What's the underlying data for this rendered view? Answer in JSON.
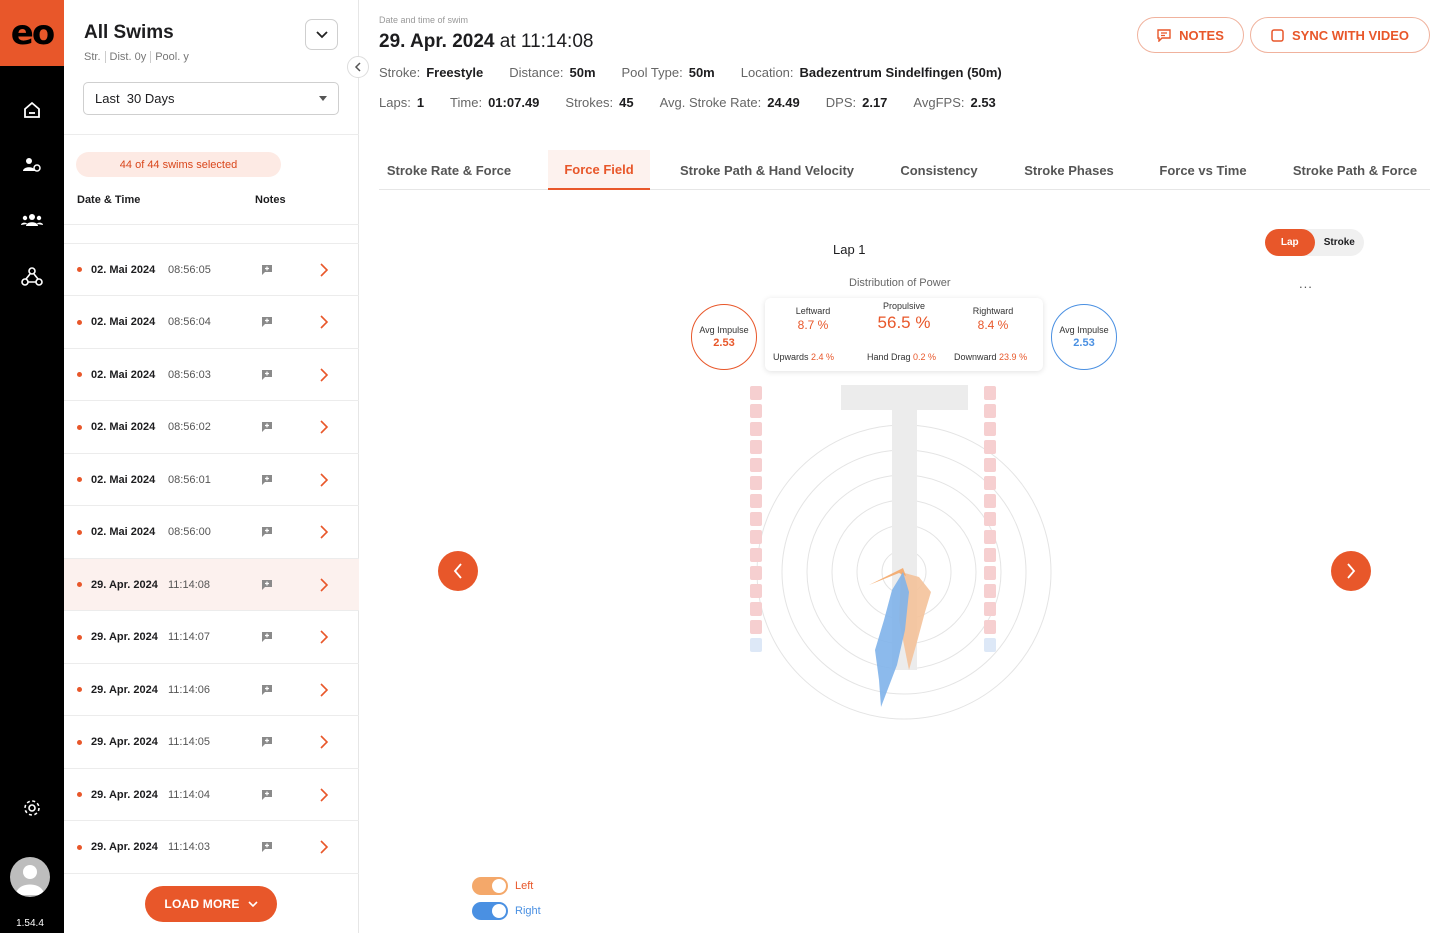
{
  "sidebar": {
    "logo": "eo",
    "version": "1.54.4",
    "icons": [
      "home-icon",
      "user-settings-icon",
      "team-icon",
      "network-icon"
    ],
    "settings_icon": "gear-icon"
  },
  "swim_list": {
    "title": "All Swims",
    "filters": [
      "Str.",
      "Dist. 0y",
      "Pool. y"
    ],
    "date_range": "Last  30 Days",
    "selected_text": "44 of 44 swims selected",
    "col_date": "Date & Time",
    "col_notes": "Notes",
    "rows": [
      {
        "date": "02. Mai 2024",
        "time": "08:56:05",
        "active": false
      },
      {
        "date": "02. Mai 2024",
        "time": "08:56:04",
        "active": false
      },
      {
        "date": "02. Mai 2024",
        "time": "08:56:03",
        "active": false
      },
      {
        "date": "02. Mai 2024",
        "time": "08:56:02",
        "active": false
      },
      {
        "date": "02. Mai 2024",
        "time": "08:56:01",
        "active": false
      },
      {
        "date": "02. Mai 2024",
        "time": "08:56:00",
        "active": false
      },
      {
        "date": "29. Apr. 2024",
        "time": "11:14:08",
        "active": true
      },
      {
        "date": "29. Apr. 2024",
        "time": "11:14:07",
        "active": false
      },
      {
        "date": "29. Apr. 2024",
        "time": "11:14:06",
        "active": false
      },
      {
        "date": "29. Apr. 2024",
        "time": "11:14:05",
        "active": false
      },
      {
        "date": "29. Apr. 2024",
        "time": "11:14:04",
        "active": false
      },
      {
        "date": "29. Apr. 2024",
        "time": "11:14:03",
        "active": false
      }
    ],
    "load_more": "LOAD MORE"
  },
  "header": {
    "meta_label": "Date and time of swim",
    "date": "29. Apr. 2024",
    "at": "at",
    "time": "11:14:08",
    "notes_button": "NOTES",
    "sync_button": "SYNC WITH VIDEO",
    "info1": [
      {
        "label": "Stroke:",
        "value": "Freestyle"
      },
      {
        "label": "Distance:",
        "value": "50m"
      },
      {
        "label": "Pool Type:",
        "value": "50m"
      },
      {
        "label": "Location:",
        "value": "Badezentrum Sindelfingen (50m)"
      }
    ],
    "info2": [
      {
        "label": "Laps:",
        "value": "1"
      },
      {
        "label": "Time:",
        "value": "01:07.49"
      },
      {
        "label": "Strokes:",
        "value": "45"
      },
      {
        "label": "Avg. Stroke Rate:",
        "value": "24.49"
      },
      {
        "label": "DPS:",
        "value": "2.17"
      },
      {
        "label": "AvgFPS:",
        "value": "2.53"
      }
    ]
  },
  "tabs": [
    {
      "label": "Stroke Rate & Force",
      "active": false
    },
    {
      "label": "Force Field",
      "active": true
    },
    {
      "label": "Stroke Path & Hand Velocity",
      "active": false
    },
    {
      "label": "Consistency",
      "active": false
    },
    {
      "label": "Stroke Phases",
      "active": false
    },
    {
      "label": "Force vs Time",
      "active": false
    },
    {
      "label": "Stroke Path & Force",
      "active": false
    }
  ],
  "force_field": {
    "lap_title": "Lap 1",
    "segment": {
      "lap": "Lap",
      "stroke": "Stroke",
      "selected": "Lap"
    },
    "distribution_title": "Distribution of Power",
    "more": "...",
    "left_impulse": {
      "label": "Avg Impulse",
      "value": "2.53",
      "color": "#e8572a"
    },
    "right_impulse": {
      "label": "Avg Impulse",
      "value": "2.53",
      "color": "#4a90e2"
    },
    "leftward": {
      "label": "Leftward",
      "value": "8.7 %"
    },
    "propulsive": {
      "label": "Propulsive",
      "value": "56.5 %"
    },
    "rightward": {
      "label": "Rightward",
      "value": "8.4 %"
    },
    "upwards": {
      "label": "Upwards",
      "value": "2.4 %"
    },
    "hand_drag": {
      "label": "Hand Drag",
      "value": "0.2 %"
    },
    "downward": {
      "label": "Downward",
      "value": "23.9 %"
    },
    "legend": [
      {
        "label": "Left",
        "color": "#f4a86a",
        "text_color": "#e8572a"
      },
      {
        "label": "Right",
        "color": "#4a90e2",
        "text_color": "#4a90e2"
      }
    ]
  },
  "colors": {
    "accent": "#e8572a",
    "left": "#f4a86a",
    "right": "#4a90e2"
  }
}
